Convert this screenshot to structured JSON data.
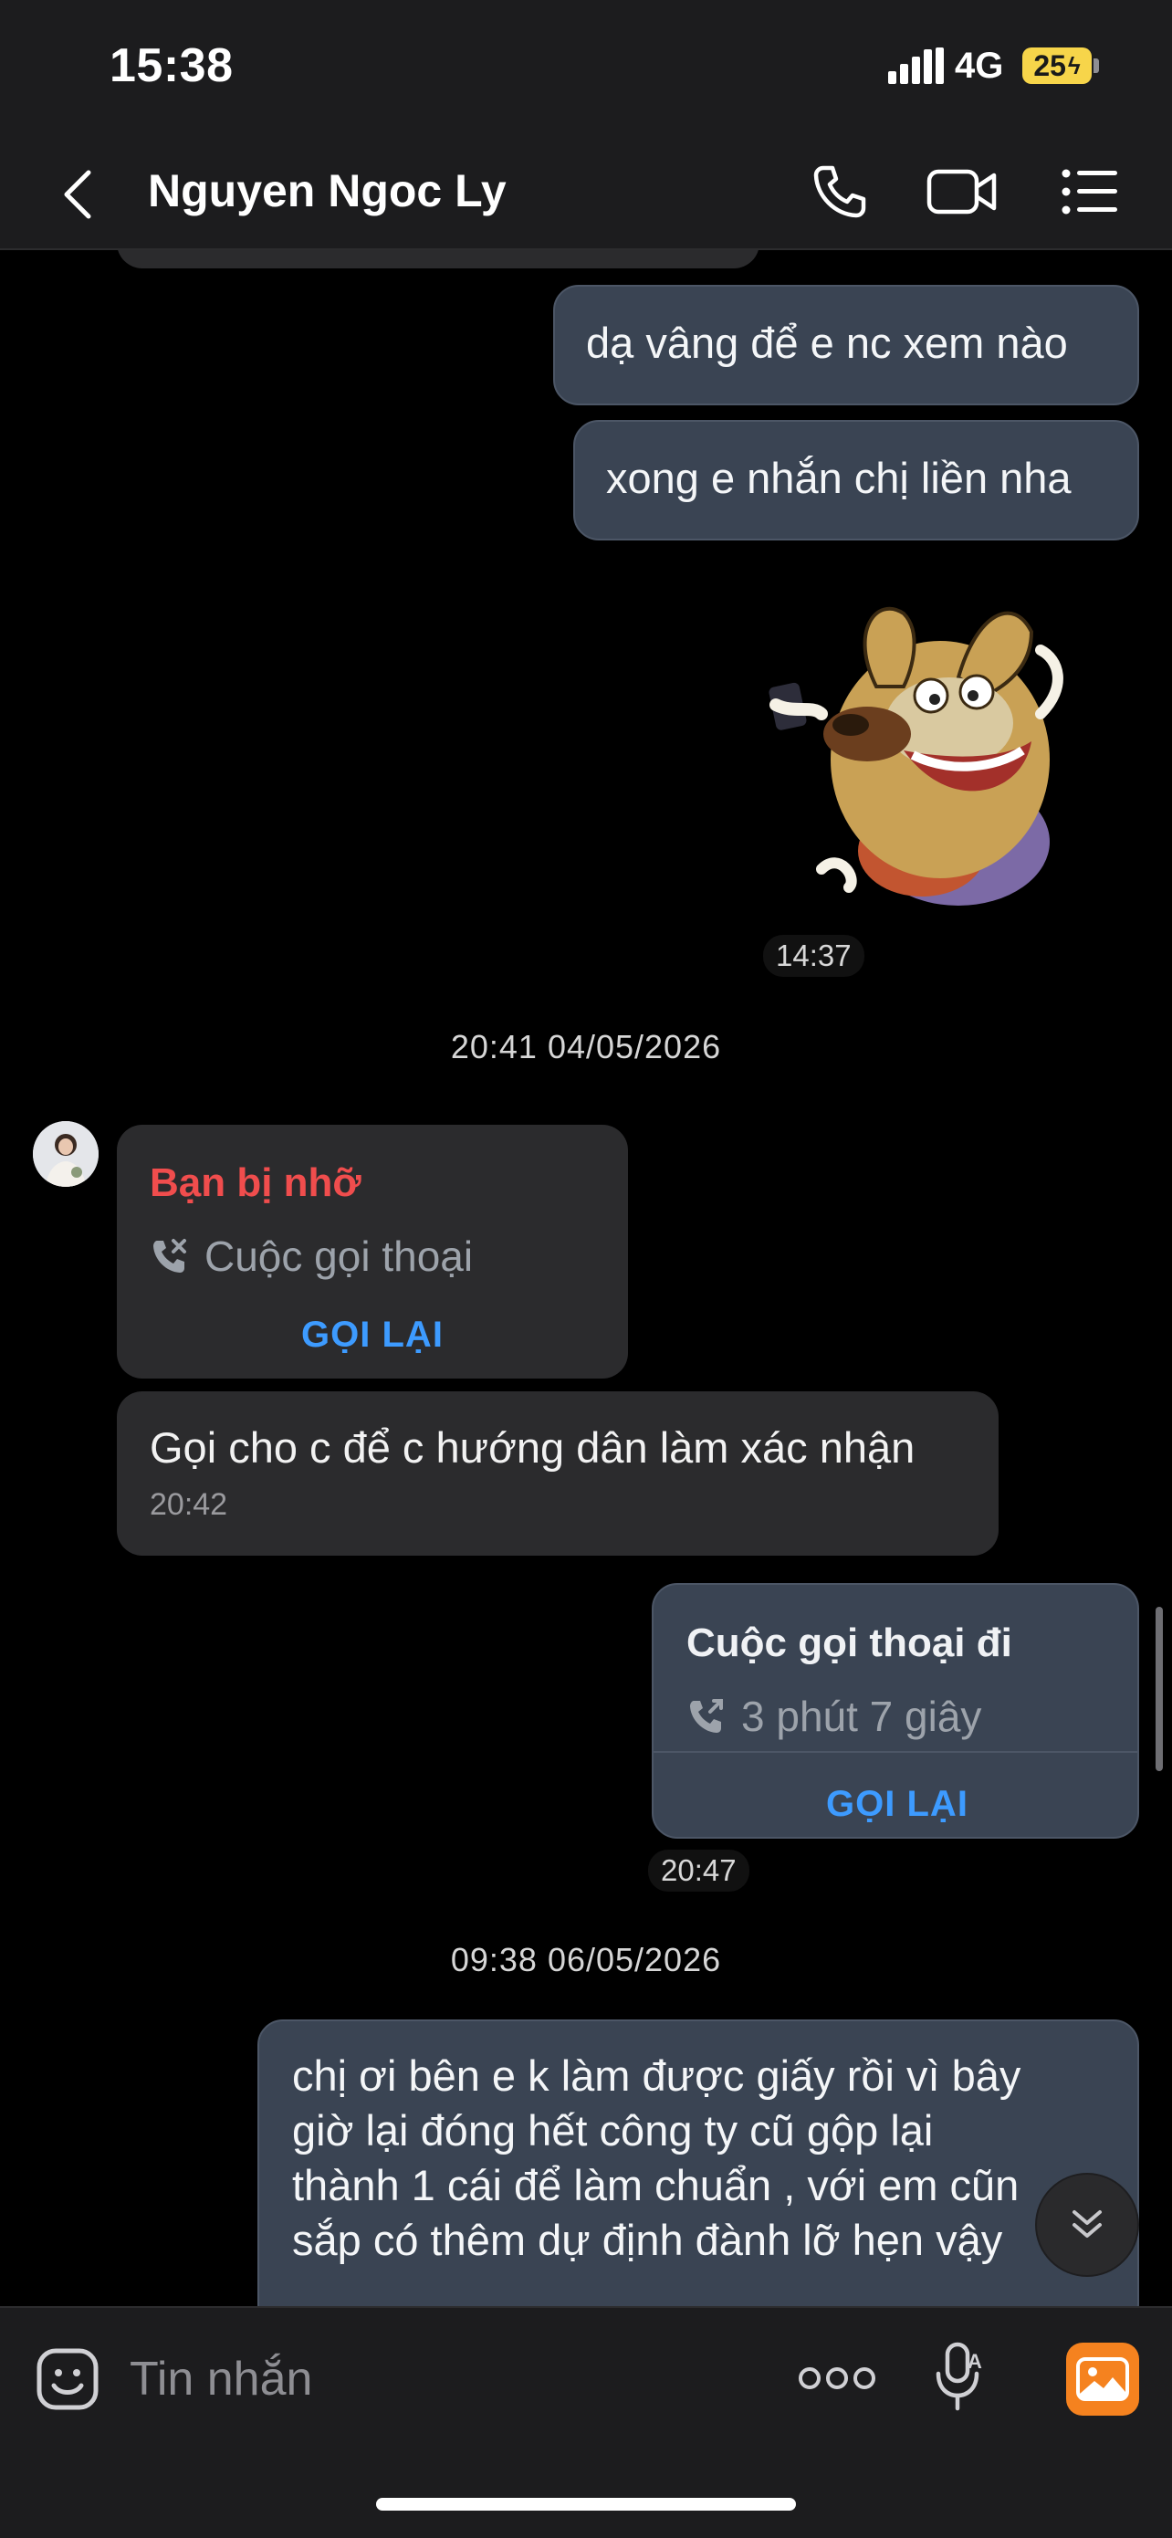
{
  "status_bar": {
    "time": "15:38",
    "network": "4G",
    "battery": "25"
  },
  "header": {
    "contact_name": "Nguyen Ngoc Ly",
    "icons": [
      "back-icon",
      "phone-icon",
      "video-icon",
      "menu-icon"
    ]
  },
  "messages": {
    "out_1": "dạ vâng để e nc xem nào",
    "out_2": "xong e nhắn chị liền nha",
    "sticker_time": "14:37",
    "date_1": "20:41 04/05/2026",
    "missed_call": {
      "title": "Bạn bị nhỡ",
      "subtitle": "Cuộc gọi thoại",
      "action": "GỌI LẠI"
    },
    "in_1": {
      "text": "Gọi cho c để c hướng dân làm xác nhận",
      "time": "20:42"
    },
    "outgoing_call": {
      "title": "Cuộc gọi thoại đi",
      "subtitle": "3 phút 7 giây",
      "action": "GỌI LẠI",
      "time": "20:47"
    },
    "date_2": "09:38 06/05/2026",
    "out_3_lines": [
      "chị ơi bên e k làm được giấy rồi vì bây",
      "giờ lại đóng hết công ty cũ gộp lại",
      "thành 1 cái để làm chuẩn , với em cũn",
      "sắp có thêm dự định đành lỡ hẹn vậy"
    ]
  },
  "composer": {
    "placeholder": "Tin nhắn"
  },
  "colors": {
    "background": "#000000",
    "bar": "#1c1c1e",
    "outgoing_bubble": "#3a4453",
    "incoming_bubble": "#2b2b2d",
    "missed_red": "#f04d4d",
    "action_blue": "#3d9bff",
    "battery_yellow": "#f7d54a",
    "image_button_orange": "#f5821f"
  }
}
